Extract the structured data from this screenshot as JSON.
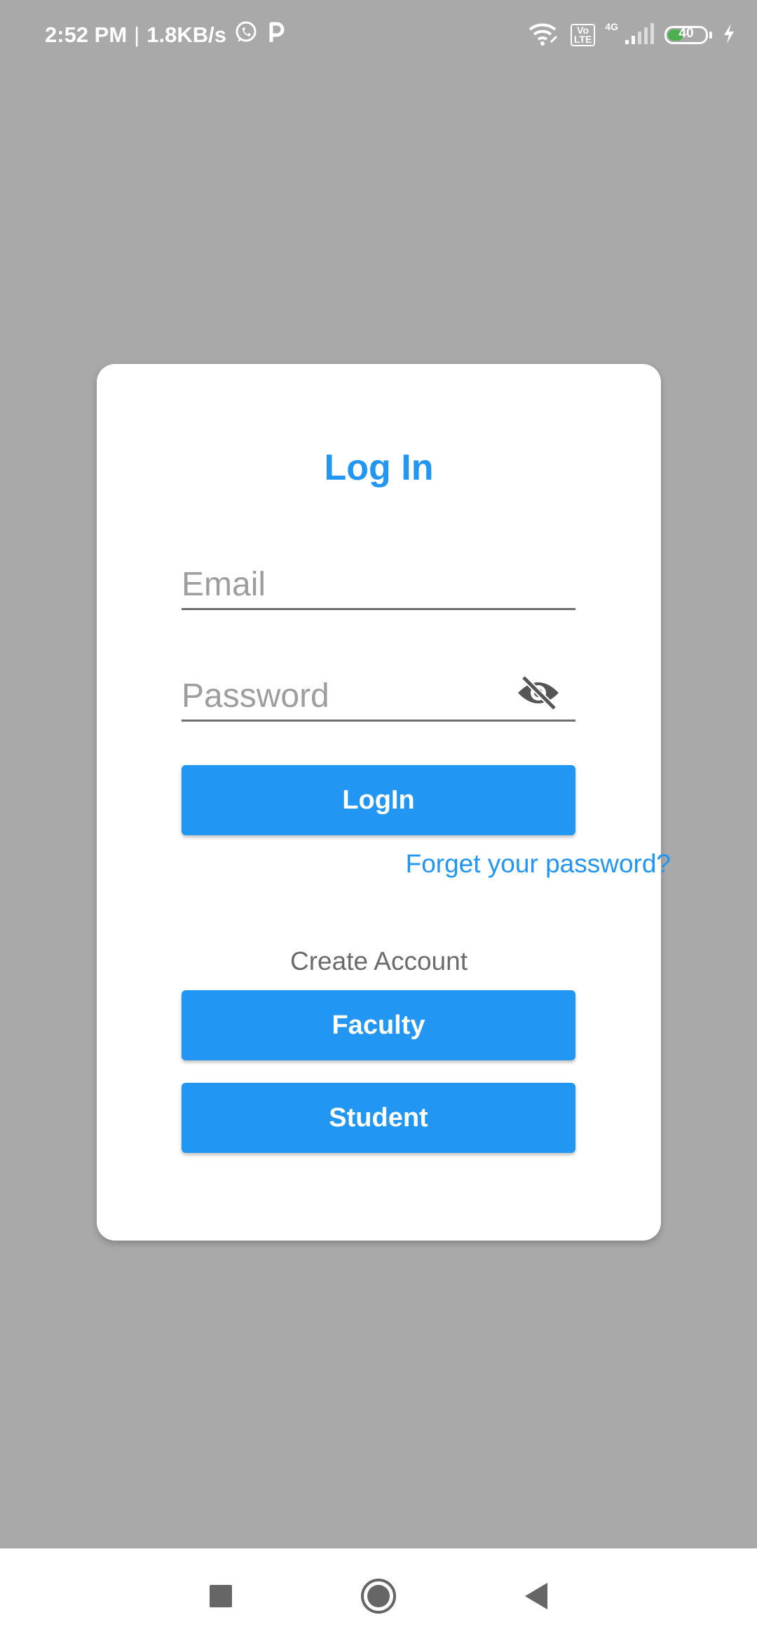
{
  "status_bar": {
    "time": "2:52 PM",
    "separator": "|",
    "net_speed": "1.8KB/s",
    "icons": [
      "whatsapp-icon",
      "p-app-icon",
      "wifi-icon",
      "volte-icon",
      "cellular-signal-icon",
      "battery-icon",
      "charging-icon"
    ],
    "volte_label_1": "Vo",
    "volte_label_2": "LTE",
    "network": "4G",
    "battery_level": "40"
  },
  "login_card": {
    "title": "Log In",
    "email_placeholder": "Email",
    "email_value": "",
    "password_placeholder": "Password",
    "password_value": "",
    "password_visibility_icon": "eye-off-icon",
    "login_button": "LogIn",
    "forgot_link": "Forget your password?",
    "create_account_label": "Create Account",
    "faculty_button": "Faculty",
    "student_button": "Student"
  },
  "nav_bar": {
    "buttons": [
      "recents-square-icon",
      "home-circle-icon",
      "back-triangle-icon"
    ]
  },
  "colors": {
    "accent": "#2196f3",
    "background": "#a9a9a9",
    "card": "#ffffff",
    "battery_fill": "#4caf50"
  }
}
